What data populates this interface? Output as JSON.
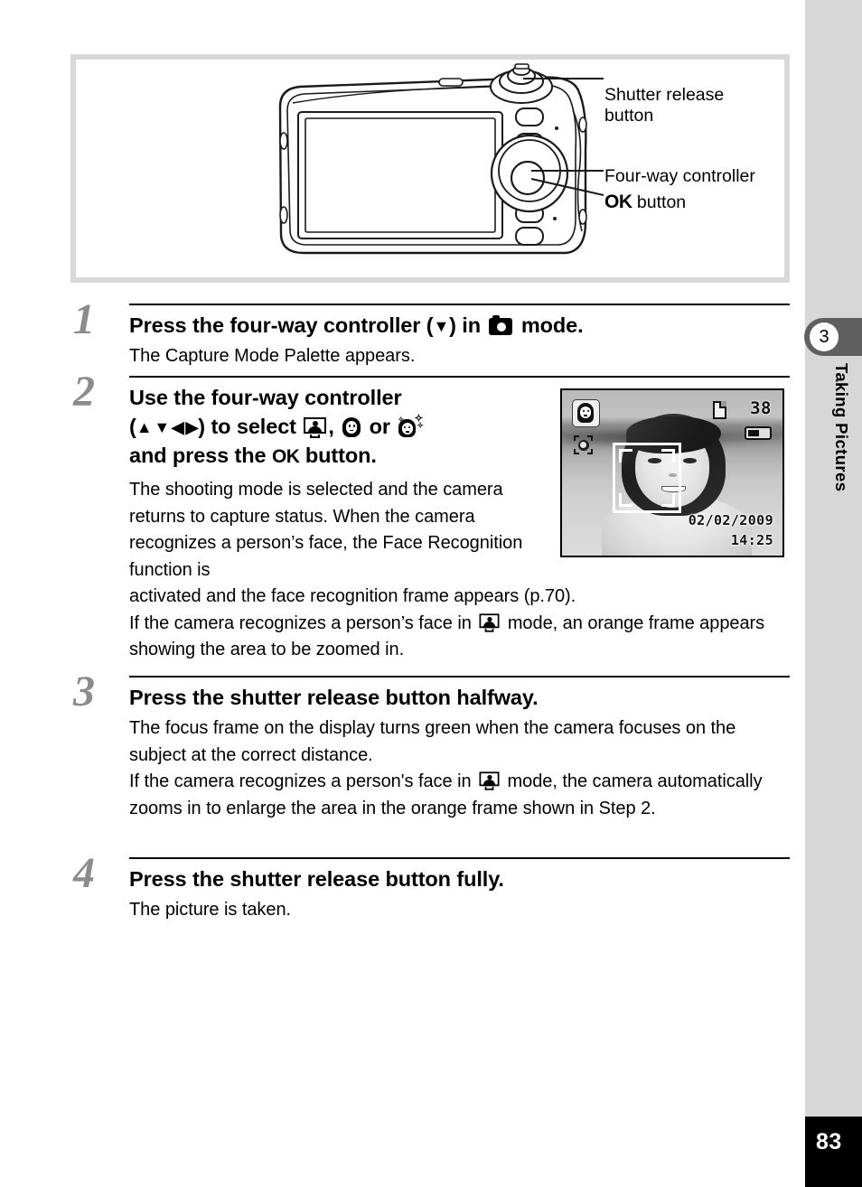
{
  "figure": {
    "callouts": [
      {
        "id": "shutter-release",
        "line1": "Shutter release",
        "line2": "button"
      },
      {
        "id": "four-way-controller",
        "line1": "Four-way controller"
      },
      {
        "id": "ok-button",
        "ok_glyph": "OK",
        "suffix": "button"
      }
    ]
  },
  "steps": [
    {
      "number": "1",
      "heading_pre": "Press the four-way controller (",
      "heading_arrow": "▼",
      "heading_mid": ") in ",
      "heading_post": " mode.",
      "text": "The Capture Mode Palette appears."
    },
    {
      "number": "2",
      "heading_line1": "Use the four-way controller",
      "heading_l2_open": "(",
      "heading_l2_arrows": [
        "▲",
        "▼",
        "◀",
        "▶"
      ],
      "heading_l2_close": ") to select ",
      "heading_l2_comma": ", ",
      "heading_l2_or": " or ",
      "heading_line3_pre": "and press the ",
      "heading_line3_ok": "OK",
      "heading_line3_post": " button.",
      "text_narrow": "The shooting mode is selected and the camera returns to capture status. When the camera recognizes a person’s face, the Face Recognition function is",
      "text_full_a": "activated and the face recognition frame appears (p.70).",
      "text_full_b_pre": "If the camera recognizes a person’s face in ",
      "text_full_b_post": " mode, an orange frame appears showing the area to be zoomed in."
    },
    {
      "number": "3",
      "heading": "Press the shutter release button halfway.",
      "text_a": "The focus frame on the display turns green when the camera focuses on the subject at the correct distance.",
      "text_b_pre": "If the camera recognizes a person's face in ",
      "text_b_post": " mode, the camera automatically zooms in to enlarge the area in the orange frame shown in Step 2."
    },
    {
      "number": "4",
      "heading": "Press the shutter release button fully.",
      "text": "The picture is taken."
    }
  ],
  "lcd": {
    "shots_remaining": "38",
    "date": "02/02/2009",
    "time": "14:25"
  },
  "sidebar": {
    "chapter_number": "3",
    "chapter_title": "Taking Pictures",
    "page_number": "83"
  },
  "colors": {
    "sidebar_strip": "#d7d7d7",
    "chapter_tab": "#5f5f5f",
    "step_number": "#8c8c8c",
    "figure_border": "#d9d9d9",
    "page_box": "#000000"
  }
}
